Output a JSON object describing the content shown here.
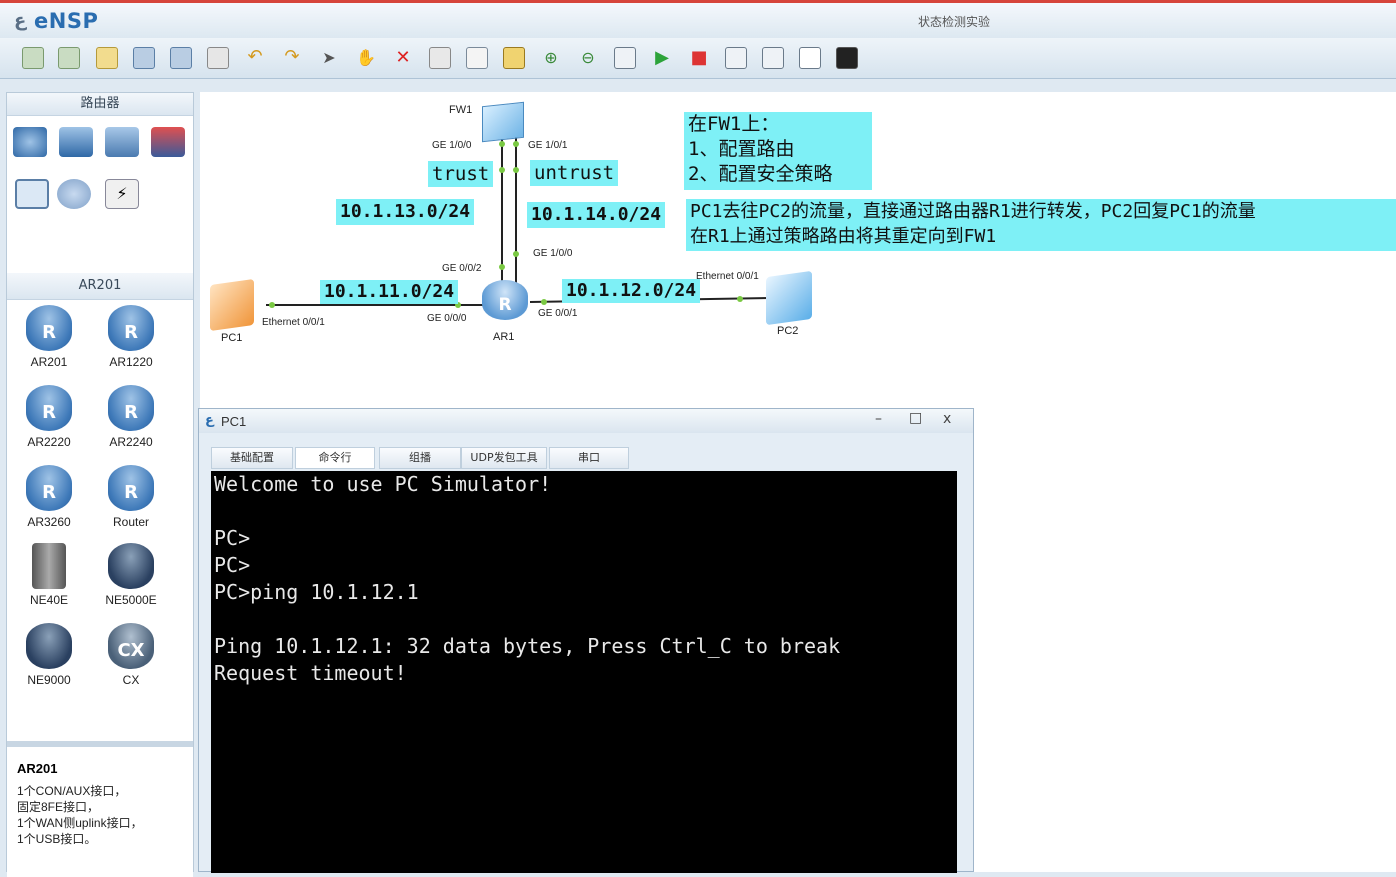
{
  "app": {
    "title": "eNSP",
    "window_title": "状态检测实验"
  },
  "toolbar": {
    "icons": [
      "new-topology-icon",
      "new-lab-icon",
      "open-icon",
      "save-icon",
      "save-as-icon",
      "print-icon",
      "undo-icon",
      "redo-icon",
      "select-icon",
      "hand-icon",
      "delete-icon",
      "delete-link-icon",
      "text-icon",
      "palette-icon",
      "zoom-in-icon",
      "zoom-out-icon",
      "start-all-icon",
      "run-icon",
      "stop-icon",
      "capture-icon",
      "topology-icon",
      "grid-icon",
      "console-icon"
    ]
  },
  "sidebar": {
    "category_header": "路由器",
    "device_header": "AR201",
    "devices": [
      {
        "label": "AR201"
      },
      {
        "label": "AR1220"
      },
      {
        "label": "AR2220"
      },
      {
        "label": "AR2240"
      },
      {
        "label": "AR3260"
      },
      {
        "label": "Router"
      },
      {
        "label": "NE40E"
      },
      {
        "label": "NE5000E"
      },
      {
        "label": "NE9000"
      },
      {
        "label": "CX"
      }
    ],
    "description": {
      "title": "AR201",
      "lines": [
        "1个CON/AUX接口，",
        "固定8FE接口，",
        "1个WAN侧uplink接口，",
        "1个USB接口。"
      ]
    }
  },
  "topology": {
    "nodes": {
      "fw1": "FW1",
      "ar1": "AR1",
      "pc1": "PC1",
      "pc2": "PC2"
    },
    "ports": {
      "fw1_g100": "GE 1/0/0",
      "fw1_g101": "GE 1/0/1",
      "ar1_g002": "GE 0/0/2",
      "ar1_g100": "GE 1/0/0",
      "ar1_g000": "GE 0/0/0",
      "ar1_g001": "GE 0/0/1",
      "pc1_eth": "Ethernet 0/0/1",
      "pc2_eth": "Ethernet 0/0/1"
    },
    "zones": {
      "trust": "trust",
      "untrust": "untrust"
    },
    "subnets": {
      "s13": "10.1.13.0/24",
      "s14": "10.1.14.0/24",
      "s11": "10.1.11.0/24",
      "s12": "10.1.12.0/24"
    },
    "notes": {
      "fw_tasks": [
        "在FW1上：",
        "1、配置路由",
        "2、配置安全策略"
      ],
      "flow_note": [
        "PC1去往PC2的流量，直接通过路由器R1进行转发，PC2回复PC1的流量",
        "在R1上通过策略路由将其重定向到FW1"
      ]
    }
  },
  "pc_window": {
    "title": "PC1",
    "controls": {
      "minimize": "–",
      "maximize": "□",
      "close": "x"
    },
    "tabs": [
      "基础配置",
      "命令行",
      "组播",
      "UDP发包工具",
      "串口"
    ],
    "console_lines": [
      "Welcome to use PC Simulator!",
      "",
      "PC>",
      "PC>",
      "PC>ping 10.1.12.1",
      "",
      "Ping 10.1.12.1: 32 data bytes, Press Ctrl_C to break",
      "Request timeout!"
    ]
  }
}
